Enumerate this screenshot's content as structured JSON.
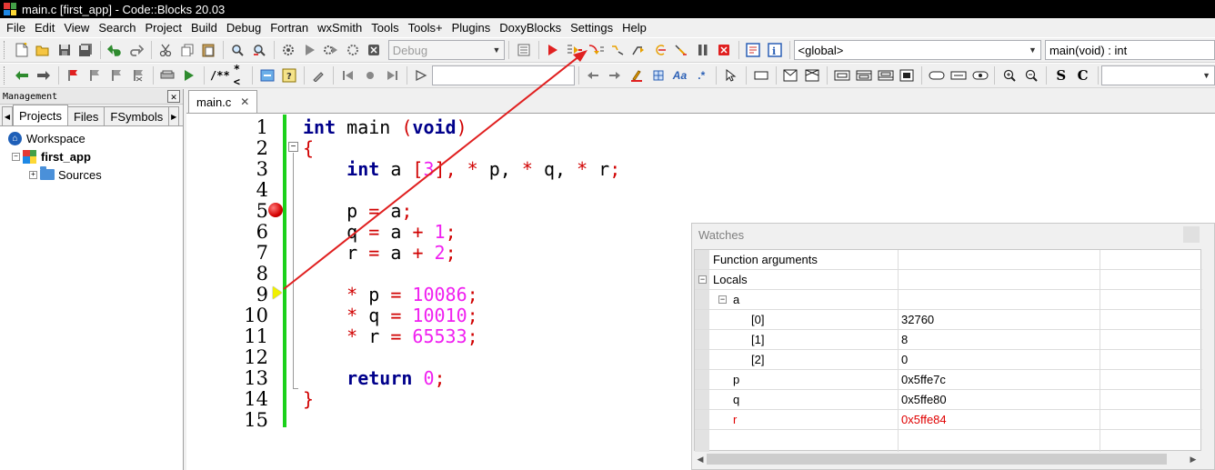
{
  "window": {
    "title": "main.c [first_app] - Code::Blocks 20.03"
  },
  "menu": [
    "File",
    "Edit",
    "View",
    "Search",
    "Project",
    "Build",
    "Debug",
    "Fortran",
    "wxSmith",
    "Tools",
    "Tools+",
    "Plugins",
    "DoxyBlocks",
    "Settings",
    "Help"
  ],
  "toolbar": {
    "build_target": "Debug",
    "scope": "<global>",
    "function": "main(void) : int",
    "doxy_comment_block": "/**",
    "doxy_comment_line": "*<",
    "search_text": "",
    "regex_label": ".*",
    "bold_label": "S",
    "class_label": "C",
    "style_combo": ""
  },
  "management": {
    "title": "Management",
    "tabs": [
      "Projects",
      "Files",
      "FSymbols"
    ],
    "active_tab": "Projects",
    "tree": {
      "workspace": "Workspace",
      "project": "first_app",
      "folder": "Sources"
    }
  },
  "editor": {
    "tab": "main.c",
    "line_numbers": [
      "1",
      "2",
      "3",
      "4",
      "5",
      "6",
      "7",
      "8",
      "9",
      "10",
      "11",
      "12",
      "13",
      "14",
      "15"
    ],
    "breakpoint_line": 5,
    "current_line": 9,
    "code": {
      "l1_kw": "int",
      "l1_name": " main ",
      "l1_po": "(",
      "l1_void": "void",
      "l1_pc": ")",
      "l2": "{",
      "l3_kw": "int",
      "l3_a": " a ",
      "l3_lb": "[",
      "l3_n": "3",
      "l3_rb": "]",
      "l3_rest1": ", ",
      "l3_s1": "*",
      "l3_p": " p, ",
      "l3_s2": "*",
      "l3_q": " q, ",
      "l3_s3": "*",
      "l3_r": " r",
      "l3_semi": ";",
      "l5_lhs": "p ",
      "l5_eq": "=",
      "l5_rhs": " a",
      "l5_semi": ";",
      "l6_lhs": "q ",
      "l6_eq": "=",
      "l6_a": " a ",
      "l6_plus": "+",
      "l6_n": " 1",
      "l6_semi": ";",
      "l7_lhs": "r ",
      "l7_eq": "=",
      "l7_a": " a ",
      "l7_plus": "+",
      "l7_n": " 2",
      "l7_semi": ";",
      "l9_s": "*",
      "l9_v": " p ",
      "l9_eq": "=",
      "l9_n": " 10086",
      "l9_semi": ";",
      "l10_s": "*",
      "l10_v": " q ",
      "l10_eq": "=",
      "l10_n": " 10010",
      "l10_semi": ";",
      "l11_s": "*",
      "l11_v": " r ",
      "l11_eq": "=",
      "l11_n": " 65533",
      "l11_semi": ";",
      "l13_kw": "return",
      "l13_n": " 0",
      "l13_semi": ";",
      "l14": "}"
    }
  },
  "watches": {
    "title": "Watches",
    "rows": [
      {
        "name": "Function arguments",
        "value": ""
      },
      {
        "name": "Locals",
        "value": ""
      },
      {
        "name": "a",
        "value": ""
      },
      {
        "name": "[0]",
        "value": "32760"
      },
      {
        "name": "[1]",
        "value": "8"
      },
      {
        "name": "[2]",
        "value": "0"
      },
      {
        "name": "p",
        "value": "0x5ffe7c"
      },
      {
        "name": "q",
        "value": "0x5ffe80"
      },
      {
        "name": "r",
        "value": "0x5ffe84"
      }
    ],
    "changed_color": "#e00000"
  },
  "colors": {
    "keyword": "#00008b",
    "number": "#f020f0",
    "operator": "#d00000",
    "current_line_bar": "#1bd11b",
    "annotation_arrow": "#e02020"
  }
}
